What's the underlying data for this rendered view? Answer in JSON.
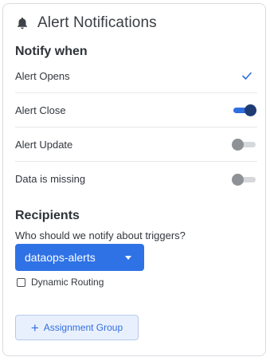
{
  "header": {
    "title": "Alert Notifications",
    "icon": "bell-icon"
  },
  "notify": {
    "heading": "Notify when",
    "items": [
      {
        "label": "Alert Opens",
        "control": "checkmark",
        "checked": true
      },
      {
        "label": "Alert Close",
        "control": "toggle",
        "on": true
      },
      {
        "label": "Alert Update",
        "control": "toggle",
        "on": false
      },
      {
        "label": "Data is missing",
        "control": "toggle",
        "on": false
      }
    ]
  },
  "recipients": {
    "heading": "Recipients",
    "question": "Who should we notify about triggers?",
    "selected": "dataops-alerts",
    "dynamic_routing_label": "Dynamic Routing",
    "dynamic_routing_checked": false,
    "assign_button_label": "Assignment Group"
  },
  "colors": {
    "accent": "#2f72e6",
    "toggle_on_knob": "#1f3b73",
    "toggle_off_knob": "#8e9297"
  }
}
